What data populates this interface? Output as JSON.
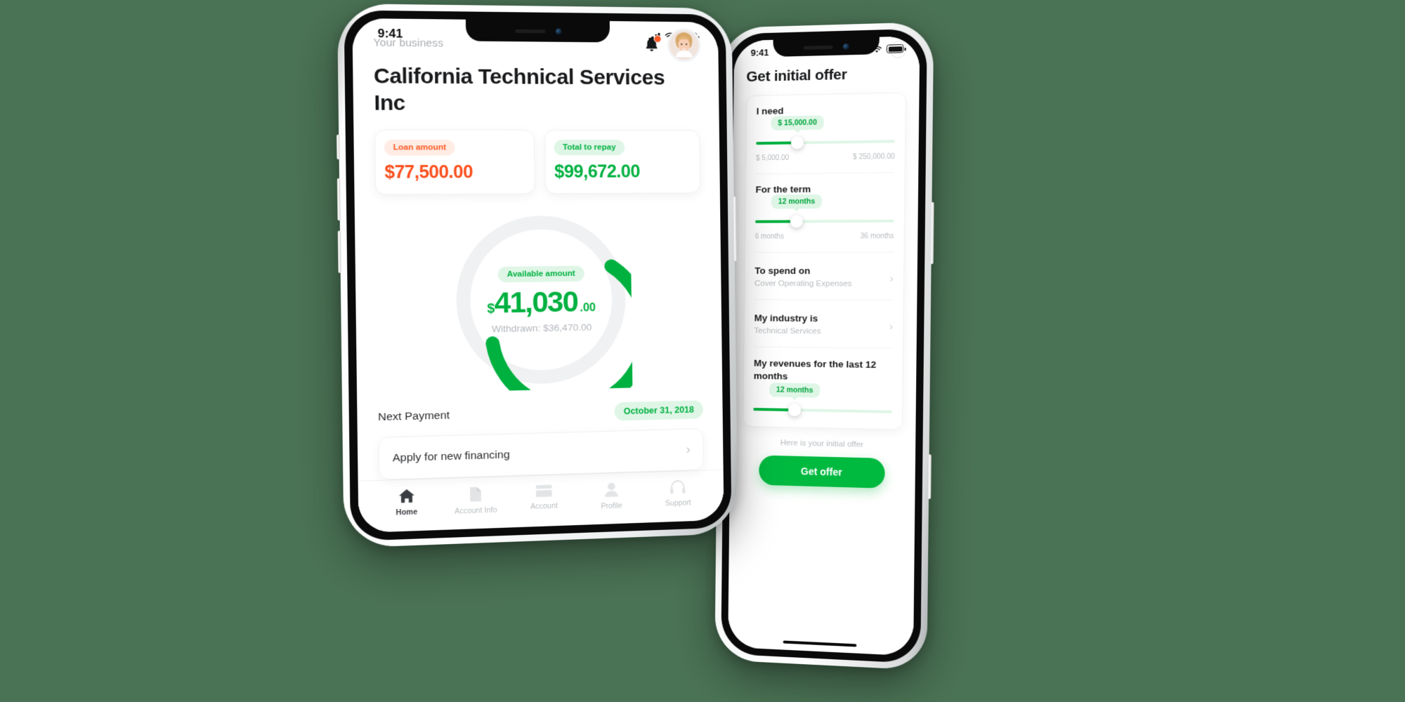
{
  "background_color": "#4a7254",
  "colors": {
    "green": "#00b140",
    "green_light": "#dff6e7",
    "orange": "#fb4f1d",
    "orange_light": "#ffece4",
    "text_dark": "#18191b",
    "text_muted": "#b7bbbf"
  },
  "front_phone": {
    "status_bar": {
      "time": "9:41",
      "signal_icon": "cellular-bars-icon",
      "wifi_icon": "wifi-icon",
      "battery_icon": "battery-icon"
    },
    "header": {
      "eyebrow": "Your business",
      "title": "California Technical Services Inc",
      "bell_icon": "bell-icon",
      "avatar_icon": "user-avatar"
    },
    "cards": [
      {
        "label": "Loan amount",
        "value": "$77,500.00",
        "tone": "orange"
      },
      {
        "label": "Total to repay",
        "value": "$99,672.00",
        "tone": "green"
      }
    ],
    "donut": {
      "badge": "Available amount",
      "currency": "$",
      "integer": "41,030",
      "decimal": ".00",
      "withdrawn": "Withdrawn: $36,470.00",
      "available_value": 41030,
      "withdrawn_value": 36470,
      "total_value": 77500,
      "percent_available": 53
    },
    "next_payment": {
      "label": "Next Payment",
      "date": "October 31, 2018"
    },
    "apply_row": {
      "label": "Apply for new financing",
      "chevron": "chevron-right-icon"
    },
    "tabs": [
      {
        "label": "Home",
        "icon": "home-icon",
        "active": true
      },
      {
        "label": "Account Info",
        "icon": "document-icon",
        "active": false
      },
      {
        "label": "Account",
        "icon": "card-icon",
        "active": false
      },
      {
        "label": "Profile",
        "icon": "person-icon",
        "active": false
      },
      {
        "label": "Support",
        "icon": "headset-icon",
        "active": false
      }
    ]
  },
  "back_phone": {
    "status_bar": {
      "time": "9:41",
      "signal_icon": "cellular-bars-icon",
      "wifi_icon": "wifi-icon",
      "battery_icon": "battery-icon"
    },
    "help_icon": "?",
    "title": "Get initial offer",
    "amount_slider": {
      "label": "I need",
      "tooltip": "$ 15,000.00",
      "min_label": "$ 5,000.00",
      "max_label": "$ 250,000.00",
      "fill_percent": 30
    },
    "term_slider": {
      "label": "For the term",
      "tooltip": "12 months",
      "min_label": "6 months",
      "max_label": "36 months",
      "fill_percent": 30
    },
    "spend_row": {
      "label": "To spend on",
      "value": "Cover Operating Expenses",
      "chevron": "chevron-right-icon"
    },
    "industry_row": {
      "label": "My industry is",
      "value": "Technical Services",
      "chevron": "chevron-right-icon"
    },
    "revenue_slider": {
      "label": "My revenues for the last 12 months",
      "tooltip": "12 months",
      "fill_percent": 30
    },
    "footnote": "Here is your initial offer",
    "cta_label": "Get offer"
  }
}
